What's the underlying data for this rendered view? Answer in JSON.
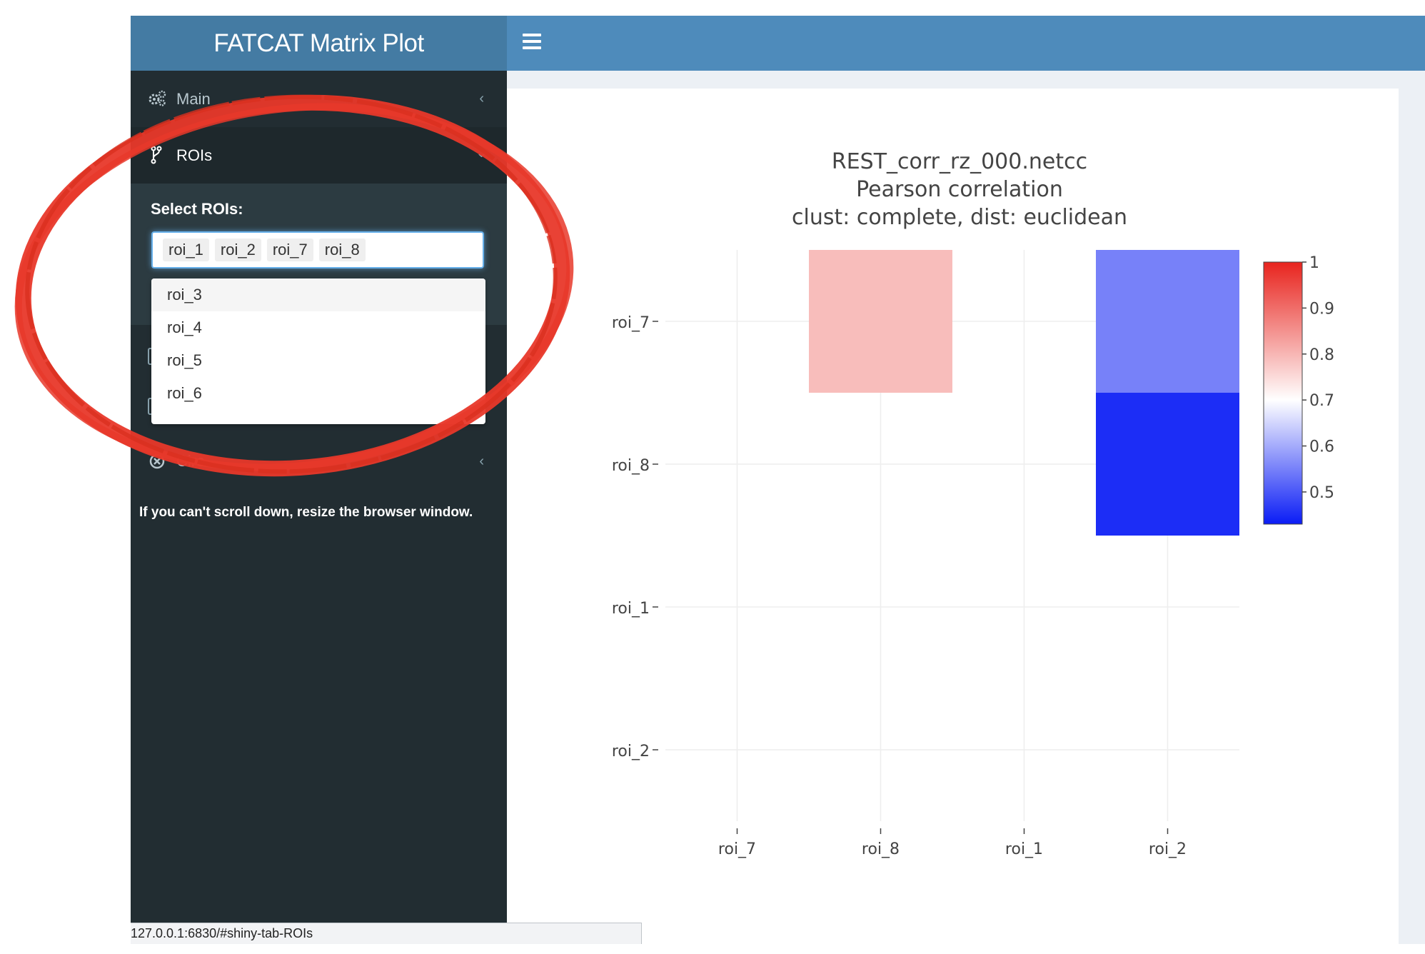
{
  "header": {
    "title": "FATCAT Matrix Plot"
  },
  "sidebar": {
    "items": [
      {
        "label": "Main"
      },
      {
        "label": "ROIs"
      },
      {
        "label": "Circ"
      }
    ],
    "rois_panel": {
      "select_label": "Select ROIs:",
      "selected": [
        "roi_1",
        "roi_2",
        "roi_7",
        "roi_8"
      ],
      "dropdown_options": [
        "roi_3",
        "roi_4",
        "roi_5",
        "roi_6"
      ]
    },
    "note": "If you can't scroll down, resize the browser window."
  },
  "status_bar": {
    "url": "127.0.0.1:6830/#shiny-tab-ROIs"
  },
  "colors": {
    "header_logo": "#447ba3",
    "header_bar": "#4e8bbb",
    "sidebar": "#222d32",
    "annotation": "#e8382a"
  },
  "chart_data": {
    "type": "heatmap",
    "title_lines": [
      "REST_corr_rz_000.netcc",
      "Pearson correlation",
      "clust: complete, dist: euclidean"
    ],
    "x_categories": [
      "roi_7",
      "roi_8",
      "roi_1",
      "roi_2"
    ],
    "y_categories": [
      "roi_7",
      "roi_8",
      "roi_1",
      "roi_2"
    ],
    "cells": [
      {
        "x": "roi_8",
        "y": "roi_7",
        "value": 0.79
      },
      {
        "x": "roi_2",
        "y": "roi_7",
        "value": 0.55
      },
      {
        "x": "roi_2",
        "y": "roi_8",
        "value": 0.45
      }
    ],
    "colorbar": {
      "min": 0.43,
      "max": 1.0,
      "ticks": [
        1,
        0.9,
        0.8,
        0.7,
        0.6,
        0.5
      ],
      "tick_labels": [
        "1",
        "0.9",
        "0.8",
        "0.7",
        "0.6",
        "0.5"
      ],
      "colorscale": [
        "#0a1cf5",
        "#ffffff",
        "#e8241e"
      ],
      "mid": 0.7
    },
    "grid": true
  }
}
